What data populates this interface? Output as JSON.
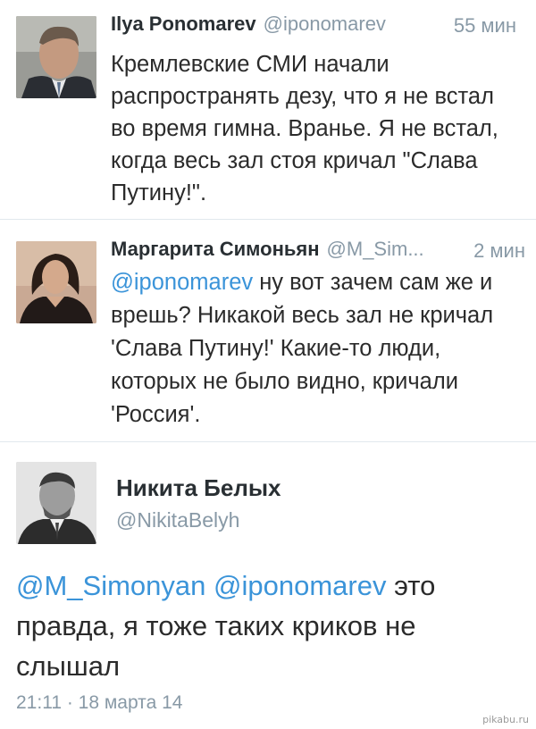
{
  "tweets": [
    {
      "name": "Ilya Ponomarev",
      "handle": "@iponomarev",
      "time": "55 мин",
      "text": "Кремлевские СМИ начали распространять дезу, что я не встал во время гимна. Вранье. Я не встал, когда весь зал стоя кричал \"Слава Путину!\"."
    },
    {
      "name": "Маргарита Симоньян",
      "handle": "@M_Sim...",
      "time": "2 мин",
      "mention": "@iponomarev",
      "text": " ну вот зачем сам же и врешь? Никакой весь зал не кричал 'Слава Путину!' Какие-то люди, которых не было видно, кричали 'Россия'."
    },
    {
      "name": "Никита Белых",
      "handle": "@NikitaBelyh",
      "mention1": "@M_Simonyan",
      "mention2": "@iponomarev",
      "text": " это правда, я тоже таких криков не слышал",
      "meta": "21:11 · 18 марта 14"
    }
  ],
  "watermark": "pikabu.ru",
  "colors": {
    "mention": "#3b94d9",
    "muted": "#8899a6",
    "divider": "#e1e8ed"
  }
}
